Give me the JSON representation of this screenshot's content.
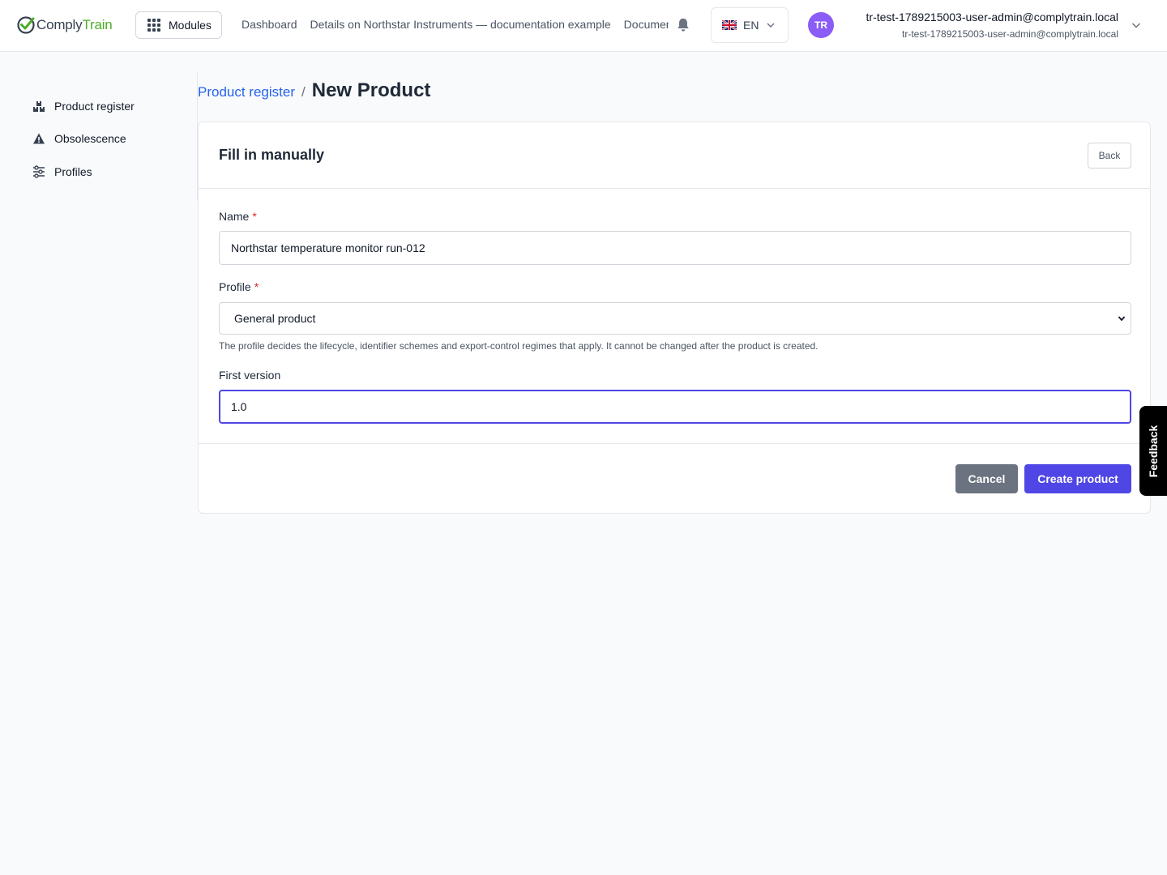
{
  "header": {
    "logo_part1": "Comply",
    "logo_part2": "Train",
    "modules_label": "Modules",
    "nav": [
      "Dashboard",
      "Details on Northstar Instruments — documentation example",
      "Documentation"
    ],
    "language": "EN",
    "avatar_initials": "TR",
    "user_name": "tr-test-1789215003-user-admin@complytrain.local",
    "user_email": "tr-test-1789215003-user-admin@complytrain.local"
  },
  "sidebar": {
    "items": [
      {
        "label": "Product register",
        "icon": "boxes-icon"
      },
      {
        "label": "Obsolescence",
        "icon": "warning-icon"
      },
      {
        "label": "Profiles",
        "icon": "sliders-icon"
      }
    ]
  },
  "breadcrumb": {
    "link": "Product register",
    "separator": "/",
    "current": "New Product"
  },
  "form": {
    "title": "Fill in manually",
    "back_label": "Back",
    "name_label": "Name",
    "name_value": "Northstar temperature monitor run-012",
    "required_marker": "*",
    "profile_label": "Profile",
    "profile_value": "General product",
    "profile_help": "The profile decides the lifecycle, identifier schemes and export-control regimes that apply. It cannot be changed after the product is created.",
    "version_label": "First version",
    "version_value": "1.0",
    "cancel_label": "Cancel",
    "create_label": "Create product"
  },
  "feedback_label": "Feedback",
  "colors": {
    "accent": "#4f46e5",
    "link": "#2563eb",
    "brand_green": "#4caf28",
    "avatar": "#8b5cf6",
    "cancel": "#6b7280",
    "required": "#dc2626"
  }
}
